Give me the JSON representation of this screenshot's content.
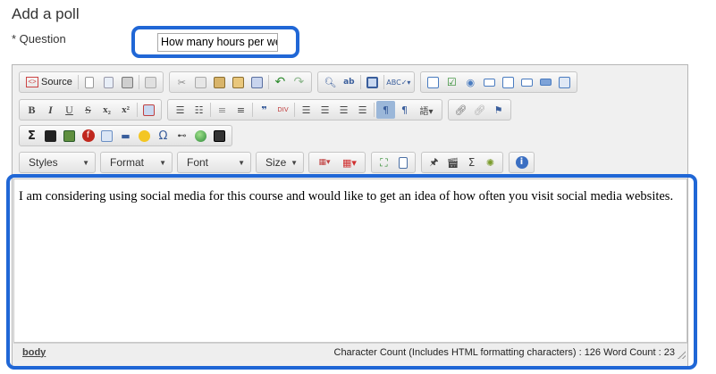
{
  "page": {
    "title": "Add a poll"
  },
  "question": {
    "label": "* Question",
    "value": "How many hours per week"
  },
  "toolbar": {
    "source_label": "Source",
    "styles_label": "Styles",
    "format_label": "Format",
    "font_label": "Font",
    "size_label": "Size",
    "bold": "B",
    "italic": "I",
    "underline": "U",
    "strike": "S",
    "subscript": "x₂",
    "superscript": "x²",
    "blockquote": "❞",
    "sigma": "Σ",
    "omega": "Ω",
    "info": "i"
  },
  "editor": {
    "content": "I am considering using social media for this course and would like to get an idea of how often you visit social media websites.",
    "path": "body",
    "counts": "Character Count (Includes HTML formatting characters) : 126 Word Count : 23"
  },
  "colors": {
    "highlight": "#2067d6"
  }
}
